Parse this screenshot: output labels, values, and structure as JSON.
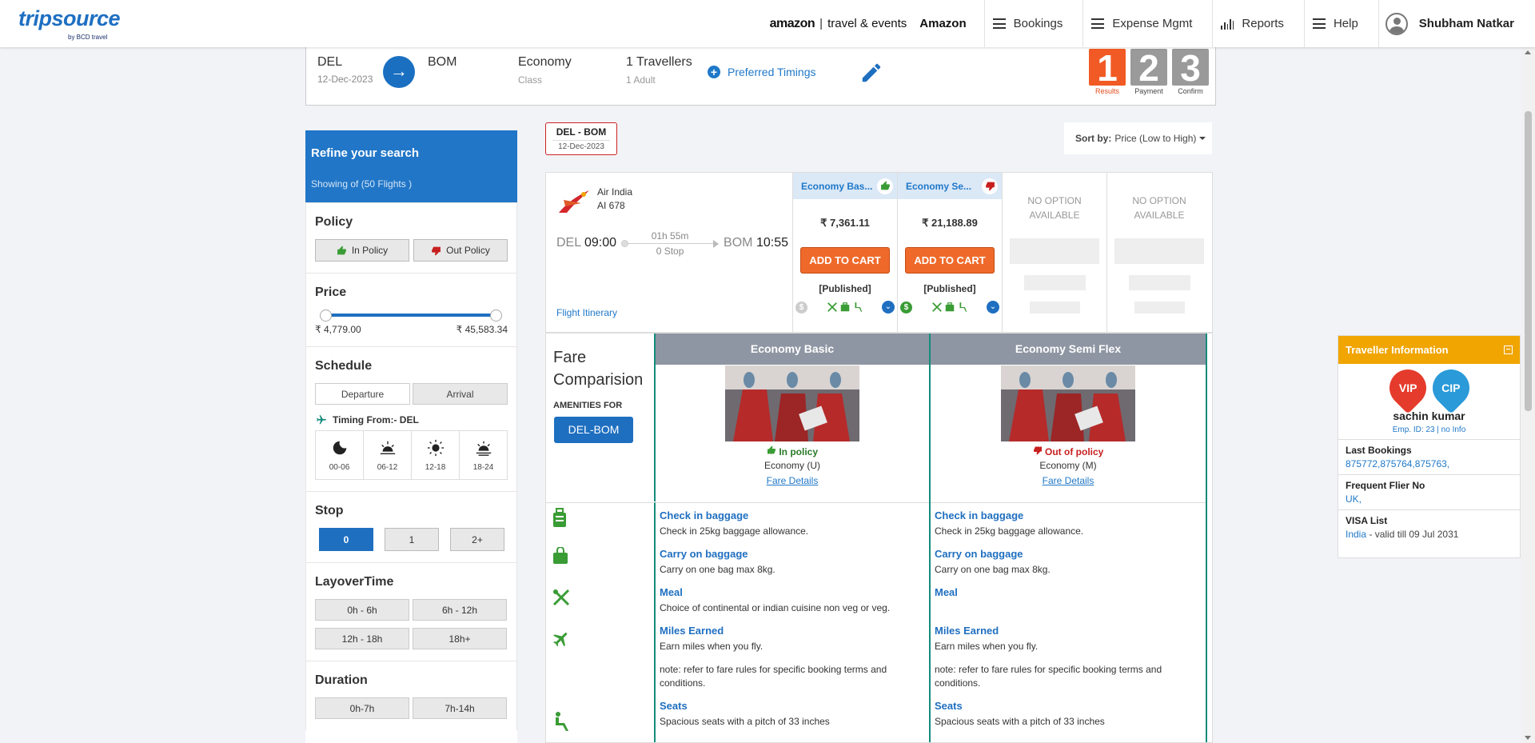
{
  "header": {
    "logo_text": "tripsource",
    "logo_sub": "by BCD travel",
    "brand_amazon": "amazon",
    "brand_travel": "travel & events",
    "company": "Amazon",
    "nav": [
      {
        "label": "Bookings",
        "icon": "menu-icon"
      },
      {
        "label": "Expense Mgmt",
        "icon": "menu-icon"
      },
      {
        "label": "Reports",
        "icon": "bar-chart-icon"
      },
      {
        "label": "Help",
        "icon": "menu-icon"
      }
    ],
    "user_name": "Shubham Natkar"
  },
  "search": {
    "from_code": "DEL",
    "from_date": "12-Dec-2023",
    "to_code": "BOM",
    "class_value": "Economy",
    "class_label": "Class",
    "travellers_value": "1 Travellers",
    "travellers_sub": "1 Adult",
    "preferred_timings": "Preferred Timings",
    "steps": [
      {
        "num": "1",
        "label": "Results",
        "active": true
      },
      {
        "num": "2",
        "label": "Payment",
        "active": false
      },
      {
        "num": "3",
        "label": "Confirm",
        "active": false
      }
    ]
  },
  "sidebar": {
    "title": "Refine your search",
    "showing": "Showing of (50 Flights )",
    "policy": {
      "title": "Policy",
      "in": "In Policy",
      "out": "Out Policy"
    },
    "price": {
      "title": "Price",
      "min": "₹ 4,779.00",
      "max": "₹ 45,583.34"
    },
    "schedule": {
      "title": "Schedule",
      "departure": "Departure",
      "arrival": "Arrival",
      "timing_from": "Timing From:- DEL",
      "slots": [
        "00-06",
        "06-12",
        "12-18",
        "18-24"
      ]
    },
    "stop": {
      "title": "Stop",
      "options": [
        "0",
        "1",
        "2+"
      ],
      "selected": "0"
    },
    "layover": {
      "title": "LayoverTime",
      "options": [
        "0h - 6h",
        "6h - 12h",
        "12h - 18h",
        "18h+"
      ]
    },
    "duration": {
      "title": "Duration",
      "options": [
        "0h-7h",
        "7h-14h"
      ]
    }
  },
  "results": {
    "route_tab": {
      "route": "DEL  -  BOM",
      "date": "12-Dec-2023"
    },
    "sort_label": "Sort by:",
    "sort_value": "Price (Low to High)",
    "flight": {
      "airline": "Air India",
      "flight_no": "AI  678",
      "dep_code": "DEL",
      "dep_time": "09:00",
      "duration": "01h 55m",
      "stops": "0 Stop",
      "arr_code": "BOM",
      "arr_time": "10:55",
      "itinerary": "Flight Itinerary"
    },
    "fares": [
      {
        "name": "Economy Bas...",
        "price": "₹ 7,361.11",
        "cart": "ADD TO CART",
        "published": "[Published]"
      },
      {
        "name": "Economy Se...",
        "price": "₹ 21,188.89",
        "cart": "ADD TO CART",
        "published": "[Published]"
      }
    ],
    "no_option": "NO OPTION AVAILABLE"
  },
  "fare_comparison": {
    "title": "Fare Comparision",
    "amenities_for": "AMENITIES FOR",
    "route": "DEL-BOM",
    "columns": [
      {
        "name": "Economy Basic",
        "policy": "In policy",
        "class": "Economy (U)",
        "details": "Fare Details",
        "checkin_title": "Check in baggage",
        "checkin": "Check in 25kg baggage allowance.",
        "carry_title": "Carry on baggage",
        "carry": "Carry on one bag max 8kg.",
        "meal_title": "Meal",
        "meal": "Choice of continental or indian cuisine non veg or veg.",
        "miles_title": "Miles Earned",
        "miles": "Earn miles when you fly.",
        "note": "note: refer to fare rules for specific booking terms and conditions.",
        "seats_title": "Seats",
        "seats": "Spacious seats with a pitch of 33 inches"
      },
      {
        "name": "Economy Semi Flex",
        "policy": "Out of policy",
        "class": "Economy (M)",
        "details": "Fare Details",
        "checkin_title": "Check in baggage",
        "checkin": "Check in 25kg baggage allowance.",
        "carry_title": "Carry on baggage",
        "carry": "Carry on one bag max 8kg.",
        "meal_title": "Meal",
        "meal": "",
        "miles_title": "Miles Earned",
        "miles": "Earn miles when you fly.",
        "note": "note: refer to fare rules for specific booking terms and conditions.",
        "seats_title": "Seats",
        "seats": "Spacious seats with a pitch of 33 inches"
      }
    ]
  },
  "traveller": {
    "title": "Traveller Information",
    "badges": [
      "VIP",
      "CIP"
    ],
    "name": "sachin kumar",
    "emp": "Emp. ID: 23 | no Info",
    "last_bookings_label": "Last Bookings",
    "last_bookings": "875772,875764,875763,",
    "ff_label": "Frequent Flier No",
    "ff_value": "UK,",
    "visa_label": "VISA List",
    "visa_country": "India",
    "visa_valid": " - valid till 09 Jul 2031"
  },
  "colors": {
    "primary_blue": "#1f6fc0",
    "orange": "#ef6a2a",
    "teal_divider": "#158c7c",
    "traveller_header": "#f0a500"
  }
}
